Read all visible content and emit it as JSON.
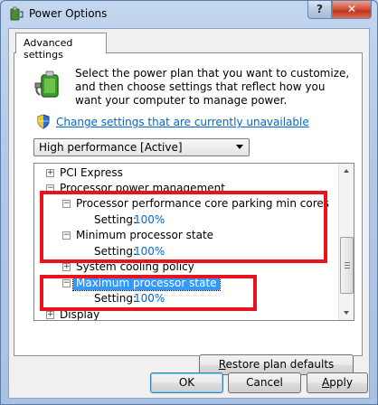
{
  "window": {
    "title": "Power Options",
    "help_label": "?",
    "close_label": "✕"
  },
  "tab": {
    "label": "Advanced settings"
  },
  "intro": {
    "text": "Select the power plan that you want to customize, and then choose settings that reflect how you want your computer to manage power.",
    "link": "Change settings that are currently unavailable"
  },
  "plan_select": {
    "value": "High performance [Active]"
  },
  "tree": {
    "items": [
      {
        "label": "PCI Express",
        "expander": "+"
      },
      {
        "label": "Processor power management",
        "expander": "−"
      },
      {
        "label": "Processor performance core parking min cores",
        "expander": "−"
      },
      {
        "setting_label": "Setting:",
        "setting_value": "100%"
      },
      {
        "label": "Minimum processor state",
        "expander": "−"
      },
      {
        "setting_label": "Setting:",
        "setting_value": "100%"
      },
      {
        "label": "System cooling policy",
        "expander": "+"
      },
      {
        "label": "Maximum processor state",
        "expander": "−"
      },
      {
        "setting_label": "Setting:",
        "setting_value": "100%"
      },
      {
        "label": "Display",
        "expander": "+"
      }
    ]
  },
  "buttons": {
    "restore_pre": "R",
    "restore_rest": "estore plan defaults",
    "ok": "OK",
    "cancel": "Cancel",
    "apply_pre": "A",
    "apply_rest": "pply"
  },
  "highlight_color": "#e8141c",
  "accent_link_color": "#0066cc",
  "selection_color": "#3399ff",
  "icons": [
    "power-plan-icon",
    "uac-shield-icon",
    "expand-icon",
    "collapse-icon",
    "scroll-up-icon",
    "scroll-down-icon"
  ]
}
